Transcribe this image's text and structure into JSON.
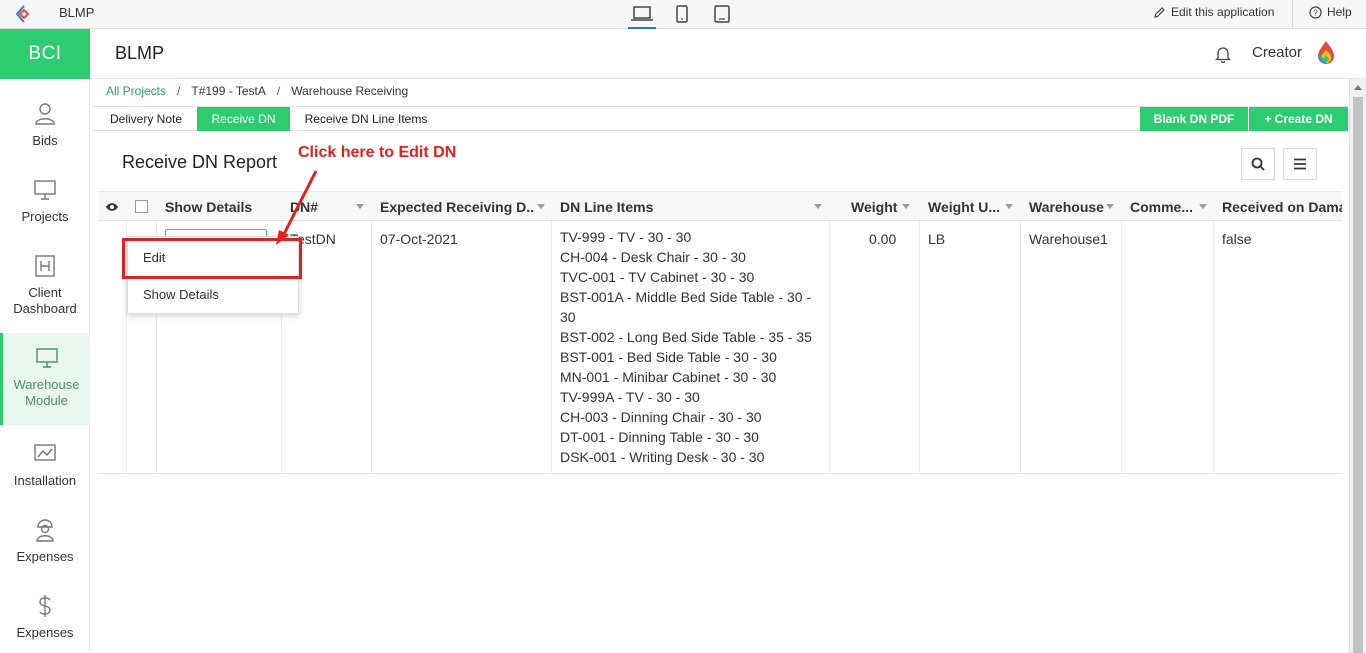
{
  "topbar": {
    "app_name": "BLMP",
    "edit_label": "Edit this application",
    "help_label": "Help"
  },
  "brand": {
    "label": "BCI"
  },
  "header": {
    "title": "BLMP",
    "user": "Creator"
  },
  "sidebar": {
    "items": [
      {
        "label": "Bids",
        "icon": "user-icon"
      },
      {
        "label": "Projects",
        "icon": "monitor-icon"
      },
      {
        "label": "Client Dashboard",
        "icon": "h-square-icon"
      },
      {
        "label": "Warehouse Module",
        "icon": "monitor-icon",
        "active": true
      },
      {
        "label": "Installation",
        "icon": "chart-image-icon"
      },
      {
        "label": "Expenses",
        "icon": "worker-icon"
      },
      {
        "label": "Expenses",
        "icon": "dollar-icon"
      }
    ]
  },
  "breadcrumb": {
    "root": "All Projects",
    "project": "T#199 - TestA",
    "page": "Warehouse Receiving"
  },
  "tabs": {
    "items": [
      "Delivery Note",
      "Receive DN",
      "Receive DN Line Items"
    ],
    "active": "Receive DN",
    "blank_pdf": "Blank DN PDF",
    "create": "+ Create DN"
  },
  "report": {
    "title": "Receive DN Report",
    "callout": "Click here to Edit DN"
  },
  "table": {
    "columns": [
      "Show Details",
      "DN#",
      "Expected Receiving D...",
      "DN Line Items",
      "Weight",
      "Weight U...",
      "Warehouse",
      "Comme...",
      "Received on Damag"
    ],
    "row": {
      "dn": "TestDN",
      "expected": "07-Oct-2021",
      "line_items": [
        "TV-999 - TV - 30 - 30",
        "CH-004 - Desk Chair - 30 - 30",
        "TVC-001 - TV Cabinet - 30 - 30",
        "BST-001A - Middle Bed Side Table - 30 - 30",
        "BST-002 - Long Bed Side Table - 35 - 35",
        "BST-001 - Bed Side Table - 30 - 30",
        "MN-001 - Minibar Cabinet - 30 - 30",
        "TV-999A - TV - 30 - 30",
        "CH-003 - Dinning Chair - 30 - 30",
        "DT-001 - Dinning Table - 30 - 30",
        "DSK-001 - Writing Desk - 30 - 30"
      ],
      "weight": "0.00",
      "weight_unit": "LB",
      "warehouse": "Warehouse1",
      "comments": "",
      "received_damaged": "false"
    }
  },
  "context_menu": {
    "items": [
      "Edit",
      "Show Details"
    ]
  },
  "colors": {
    "accent": "#2ecc71",
    "callout": "#e32020",
    "link": "#2ea05f"
  }
}
